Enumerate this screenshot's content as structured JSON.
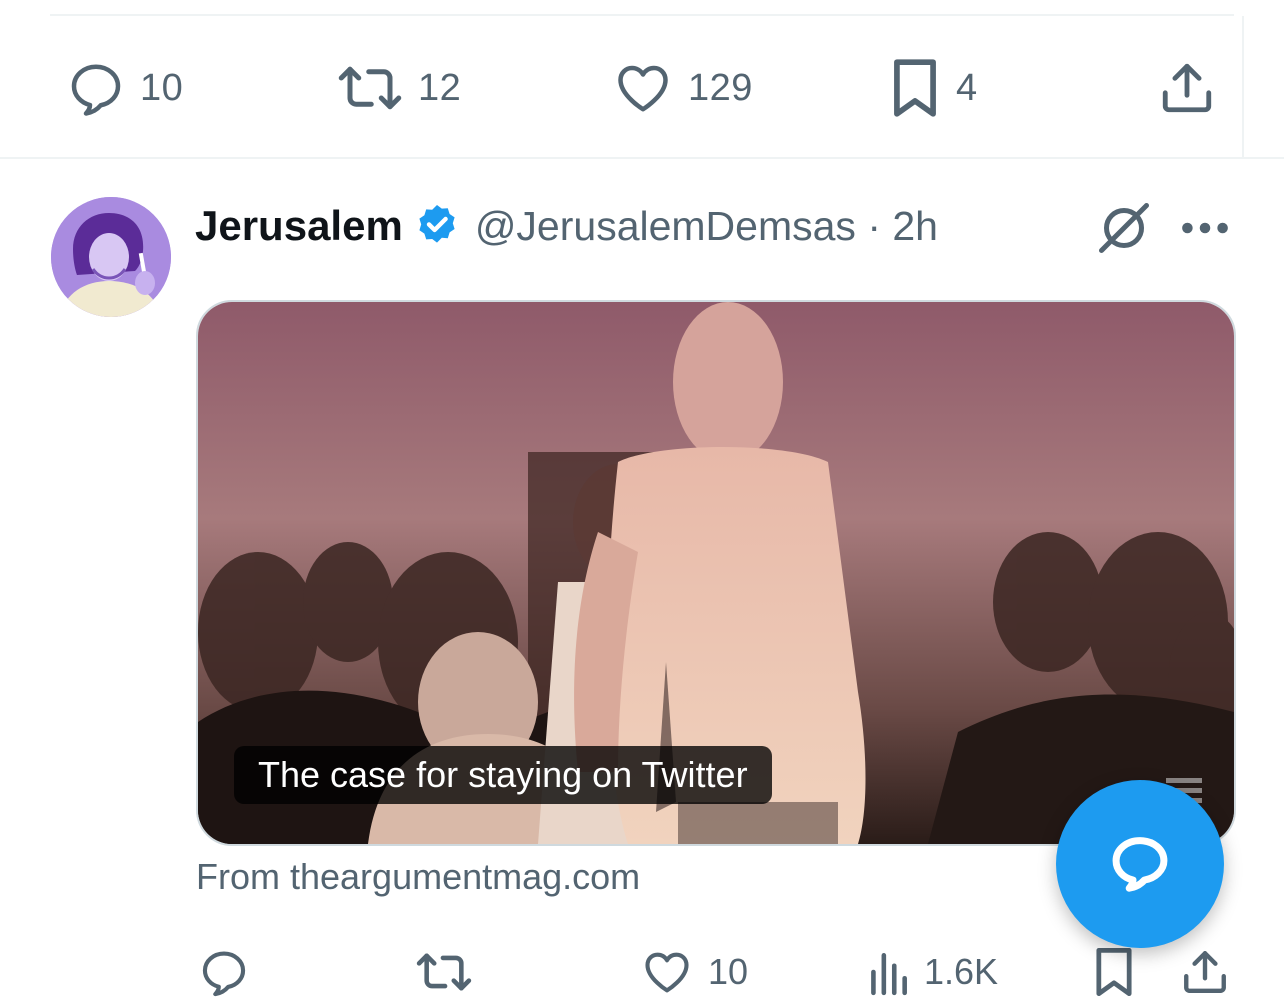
{
  "previous_tweet": {
    "actions": {
      "replies": "10",
      "retweets": "12",
      "likes": "129",
      "bookmarks": "4"
    }
  },
  "tweet": {
    "display_name": "Jerusalem",
    "handle_time": "@JerusalemDemsas · 2h",
    "card": {
      "title": "The case for staying on Twitter",
      "source": "From theargumentmag.com"
    },
    "actions": {
      "likes": "10",
      "views": "1.6K"
    }
  },
  "colors": {
    "accent": "#1d9bf0",
    "secondary_text": "#536471",
    "divider": "#eff3f4"
  },
  "icons": [
    "reply-icon",
    "retweet-icon",
    "like-icon",
    "bookmark-icon",
    "share-icon",
    "verified-badge-icon",
    "grok-icon",
    "more-icon",
    "views-icon",
    "compose-icon"
  ]
}
